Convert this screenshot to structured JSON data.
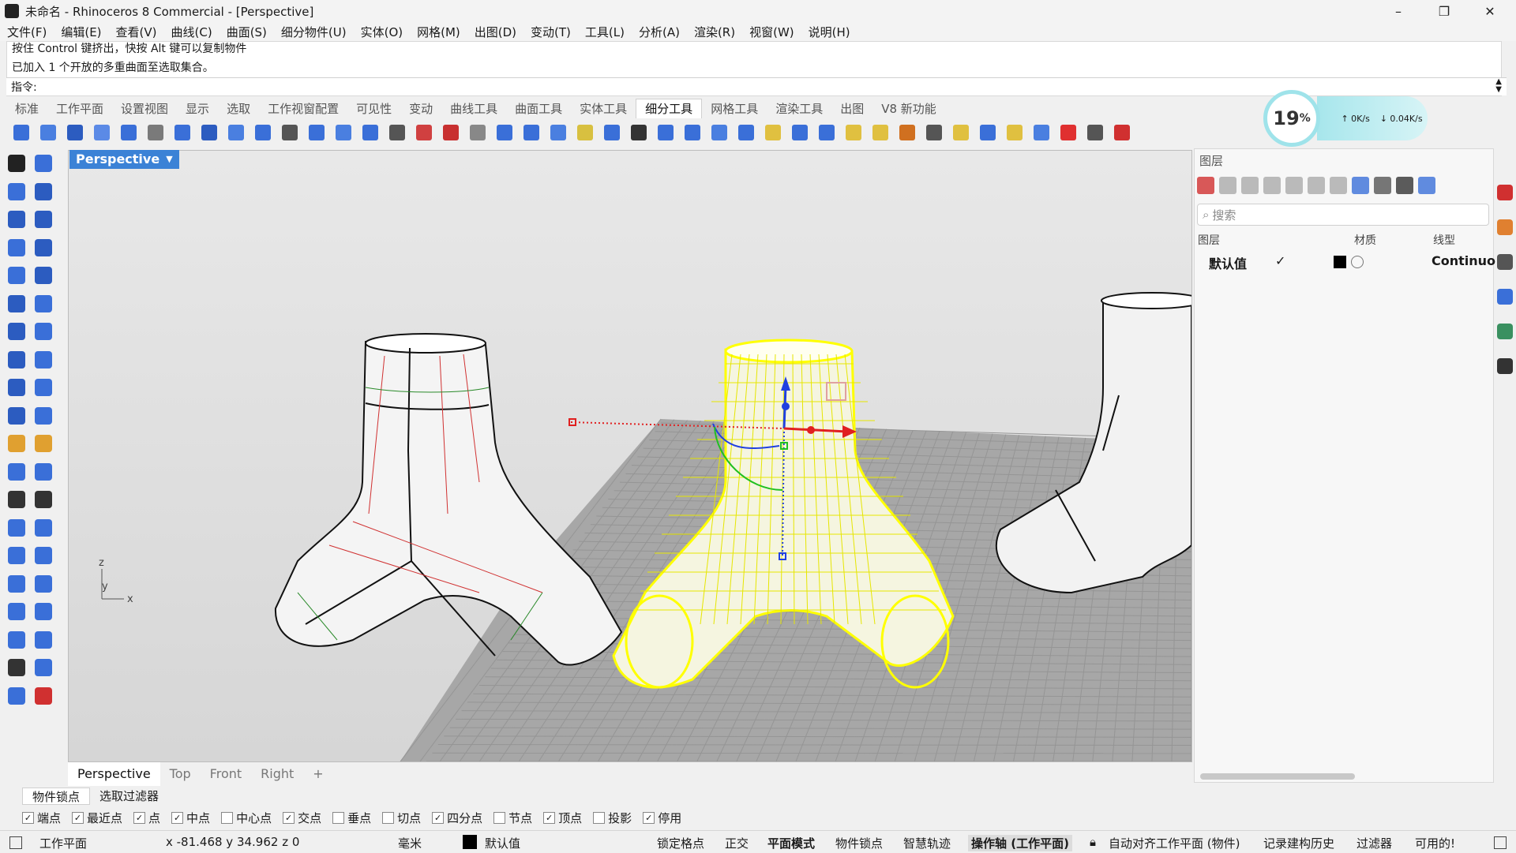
{
  "window": {
    "title": "未命名 - Rhinoceros 8 Commercial - [Perspective]",
    "minimize": "–",
    "restore": "❐",
    "close": "✕"
  },
  "menu": [
    "文件(F)",
    "编辑(E)",
    "查看(V)",
    "曲线(C)",
    "曲面(S)",
    "细分物件(U)",
    "实体(O)",
    "网格(M)",
    "出图(D)",
    "变动(T)",
    "工具(L)",
    "分析(A)",
    "渲染(R)",
    "视窗(W)",
    "说明(H)"
  ],
  "command": {
    "line1": "按住 Control 键挤出，快按 Alt 键可以复制物件",
    "line2": "已加入 1 个开放的多重曲面至选取集合。",
    "prompt": "指令:"
  },
  "toolbar_tabs": {
    "items": [
      "标准",
      "工作平面",
      "设置视图",
      "显示",
      "选取",
      "工作视窗配置",
      "可见性",
      "变动",
      "曲线工具",
      "曲面工具",
      "实体工具",
      "细分工具",
      "网格工具",
      "渲染工具",
      "出图",
      "V8 新功能"
    ],
    "active_index": 11
  },
  "network": {
    "percent": "19",
    "percent_sign": "%",
    "upload": "↑ 0K/s",
    "download": "↓ 0.04K/s"
  },
  "viewport": {
    "name": "Perspective",
    "axis_labels": {
      "z": "z",
      "y": "y",
      "x": "x"
    },
    "tabs": [
      "Perspective",
      "Top",
      "Front",
      "Right"
    ],
    "add_tab": "+"
  },
  "layers_panel": {
    "title": "图层",
    "search_placeholder": "搜索",
    "columns": {
      "layer": "图层",
      "material": "材质",
      "linetype": "线型"
    },
    "rows": [
      {
        "name": "默认值",
        "current": "✓",
        "color": "#000000",
        "linetype": "Continuo"
      }
    ]
  },
  "snap_tabs": [
    "物件锁点",
    "选取过滤器"
  ],
  "osnaps": [
    {
      "label": "端点",
      "checked": true
    },
    {
      "label": "最近点",
      "checked": true
    },
    {
      "label": "点",
      "checked": true
    },
    {
      "label": "中点",
      "checked": true
    },
    {
      "label": "中心点",
      "checked": false
    },
    {
      "label": "交点",
      "checked": true
    },
    {
      "label": "垂点",
      "checked": false
    },
    {
      "label": "切点",
      "checked": false
    },
    {
      "label": "四分点",
      "checked": true
    },
    {
      "label": "节点",
      "checked": false
    },
    {
      "label": "顶点",
      "checked": true
    },
    {
      "label": "投影",
      "checked": false
    },
    {
      "label": "停用",
      "checked": true
    }
  ],
  "status": {
    "cplane": "工作平面",
    "coords": "x -81.468   y 34.962   z 0",
    "units": "毫米",
    "layer": "默认值",
    "grid_snap": "锁定格点",
    "ortho": "正交",
    "planar": "平面模式",
    "osnap": "物件锁点",
    "smarttrack": "智慧轨迹",
    "gumball": "操作轴 (工作平面)",
    "autoalign": "自动对齐工作平面 (物件)",
    "history": "记录建构历史",
    "filter": "过滤器",
    "available": "可用的!"
  },
  "colors": {
    "accent": "#3b82d6",
    "selection": "#ffff00",
    "axis_x": "#e02020",
    "axis_y": "#20c020",
    "axis_z": "#2040e0"
  }
}
